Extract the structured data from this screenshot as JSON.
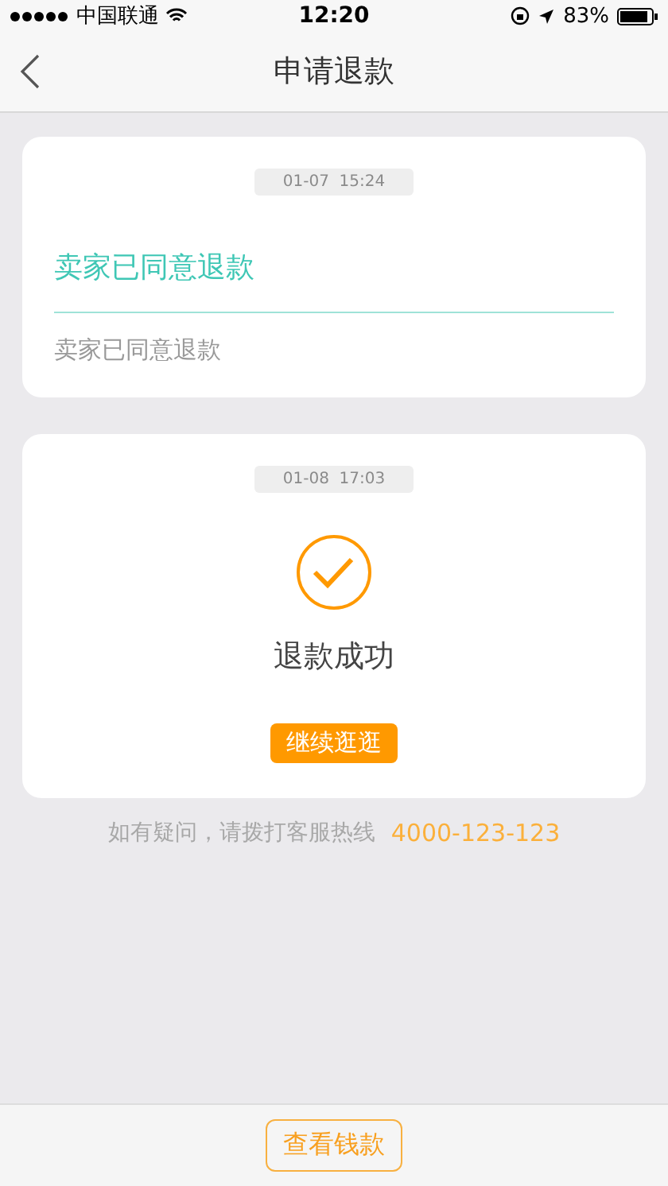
{
  "status_bar": {
    "carrier": "中国联通",
    "time": "12:20",
    "battery": "83%"
  },
  "nav": {
    "title": "申请退款"
  },
  "cards": [
    {
      "kind": "text",
      "timestamp": "01-07  15:24",
      "heading": "卖家已同意退款",
      "body": "卖家已同意退款"
    },
    {
      "kind": "success",
      "timestamp": "01-08  17:03",
      "heading": "退款成功",
      "button": "继续逛逛"
    }
  ],
  "hotline": {
    "label": "如有疑问，请拨打客服热线",
    "phone": "4000-123-123"
  },
  "bottom_button": "查看钱款"
}
